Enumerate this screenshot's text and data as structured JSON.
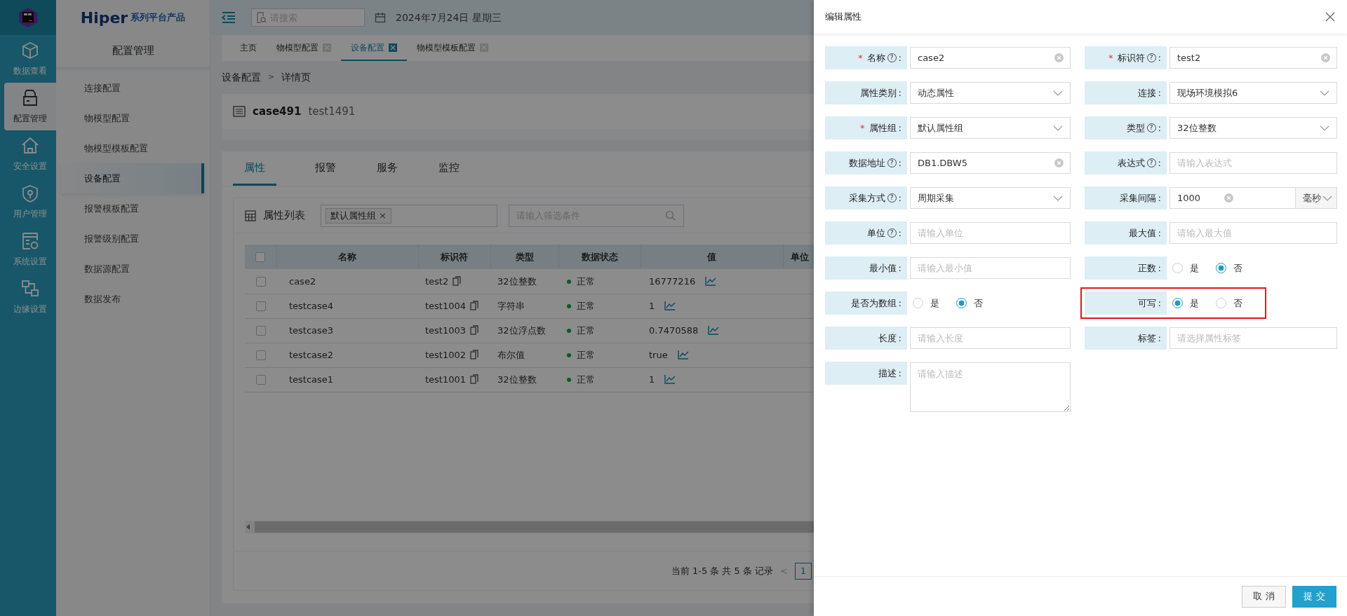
{
  "rail": [
    {
      "label": "数据查看",
      "selected": false
    },
    {
      "label": "配置管理",
      "selected": true
    },
    {
      "label": "安全设置",
      "selected": false
    },
    {
      "label": "用户管理",
      "selected": false
    },
    {
      "label": "系统设置",
      "selected": false
    },
    {
      "label": "边缘设置",
      "selected": false
    }
  ],
  "brand": {
    "name": "Hiper",
    "tagline": "系列平台产品"
  },
  "sidebar": {
    "title": "配置管理",
    "items": [
      {
        "label": "连接配置",
        "selected": false
      },
      {
        "label": "物模型配置",
        "selected": false
      },
      {
        "label": "物模型模板配置",
        "selected": false
      },
      {
        "label": "设备配置",
        "selected": true
      },
      {
        "label": "报警模板配置",
        "selected": false
      },
      {
        "label": "报警级别配置",
        "selected": false
      },
      {
        "label": "数据源配置",
        "selected": false
      },
      {
        "label": "数据发布",
        "selected": false
      }
    ]
  },
  "header": {
    "search": {
      "placeholder": "请搜索"
    },
    "date": "2024年7月24日 星期三"
  },
  "page_tabs": [
    {
      "label": "主页",
      "selected": false,
      "closable": false
    },
    {
      "label": "物模型配置",
      "selected": false,
      "closable": true
    },
    {
      "label": "设备配置",
      "selected": true,
      "closable": true
    },
    {
      "label": "物模型模板配置",
      "selected": false,
      "closable": true
    }
  ],
  "breadcrumb": {
    "items": [
      "设备配置",
      "详情页"
    ],
    "separator": ">"
  },
  "device": {
    "name": "case491",
    "identifier": "test1491"
  },
  "detail_tabs": [
    {
      "label": "属性",
      "selected": true
    },
    {
      "label": "报警",
      "selected": false
    },
    {
      "label": "服务",
      "selected": false
    },
    {
      "label": "监控",
      "selected": false
    }
  ],
  "property_list": {
    "title": "属性列表",
    "tags": [
      {
        "label": "默认属性组",
        "remove": "×"
      }
    ],
    "filter": {
      "placeholder": "请输入筛选条件"
    }
  },
  "table": {
    "all_checked": false,
    "columns": [
      "名称",
      "标识符",
      "类型",
      "数据状态",
      "值",
      "单位"
    ],
    "rows": [
      {
        "checked": false,
        "name": "case2",
        "identifier": "test2",
        "type": "32位整数",
        "status": "正常",
        "value": "16777216"
      },
      {
        "checked": false,
        "name": "testcase4",
        "identifier": "test1004",
        "type": "字符串",
        "status": "正常",
        "value": "1"
      },
      {
        "checked": false,
        "name": "testcase3",
        "identifier": "test1003",
        "type": "32位浮点数",
        "status": "正常",
        "value": "0.7470588"
      },
      {
        "checked": false,
        "name": "testcase2",
        "identifier": "test1002",
        "type": "布尔值",
        "status": "正常",
        "value": "true"
      },
      {
        "checked": false,
        "name": "testcase1",
        "identifier": "test1001",
        "type": "32位整数",
        "status": "正常",
        "value": "1"
      }
    ]
  },
  "pagination": {
    "summary": "当前 1-5 条 共 5 条 记录",
    "prev": "<",
    "pages": [
      {
        "label": "1",
        "selected": true
      }
    ]
  },
  "drawer": {
    "title": "编辑属性",
    "required_mark": "*",
    "help_mark": "?",
    "label_suffix": ":",
    "fields": [
      {
        "label": "名称",
        "required": true,
        "help": true,
        "kind": "text",
        "value": "case2",
        "clearable": true
      },
      {
        "label": "标识符",
        "required": true,
        "help": true,
        "kind": "text",
        "value": "test2",
        "clearable": true
      },
      {
        "label": "属性类别",
        "required": false,
        "help": false,
        "kind": "select",
        "value": "动态属性"
      },
      {
        "label": "连接",
        "required": false,
        "help": false,
        "kind": "select",
        "value": "现场环境模拟6"
      },
      {
        "label": "属性组",
        "required": true,
        "help": false,
        "kind": "select",
        "value": "默认属性组"
      },
      {
        "label": "类型",
        "required": false,
        "help": true,
        "kind": "select",
        "value": "32位整数"
      },
      {
        "label": "数据地址",
        "required": false,
        "help": true,
        "kind": "text",
        "value": "DB1.DBW5",
        "clearable": true
      },
      {
        "label": "表达式",
        "required": false,
        "help": true,
        "kind": "text",
        "placeholder": "请输入表达式"
      },
      {
        "label": "采集方式",
        "required": false,
        "help": true,
        "kind": "select",
        "value": "周期采集"
      },
      {
        "label": "采集间隔",
        "required": false,
        "help": false,
        "kind": "text",
        "value": "1000",
        "clearable": true,
        "unit": "毫秒"
      },
      {
        "label": "单位",
        "required": false,
        "help": true,
        "kind": "text",
        "placeholder": "请输入单位"
      },
      {
        "label": "最大值",
        "required": false,
        "help": false,
        "kind": "text",
        "placeholder": "请输入最大值"
      },
      {
        "label": "最小值",
        "required": false,
        "help": false,
        "kind": "text",
        "placeholder": "请输入最小值"
      },
      {
        "label": "正数",
        "required": false,
        "help": false,
        "kind": "radio",
        "options": [
          {
            "label": "是",
            "selected": false
          },
          {
            "label": "否",
            "selected": true
          }
        ]
      },
      {
        "label": "是否为数组",
        "required": false,
        "help": false,
        "kind": "radio",
        "options": [
          {
            "label": "是",
            "selected": false
          },
          {
            "label": "否",
            "selected": true
          }
        ]
      },
      {
        "label": "可写",
        "required": false,
        "help": false,
        "kind": "radio",
        "highlighted": true,
        "options": [
          {
            "label": "是",
            "selected": true
          },
          {
            "label": "否",
            "selected": false
          }
        ]
      },
      {
        "label": "长度",
        "required": false,
        "help": false,
        "kind": "text",
        "placeholder": "请输入长度"
      },
      {
        "label": "标签",
        "required": false,
        "help": false,
        "kind": "text",
        "placeholder": "请选择属性标签"
      },
      {
        "label": "描述",
        "required": false,
        "help": false,
        "kind": "textarea",
        "placeholder": "请输入描述"
      }
    ],
    "buttons": [
      {
        "label": "取 消",
        "kind": "secondary"
      },
      {
        "label": "提 交",
        "kind": "primary"
      }
    ]
  }
}
